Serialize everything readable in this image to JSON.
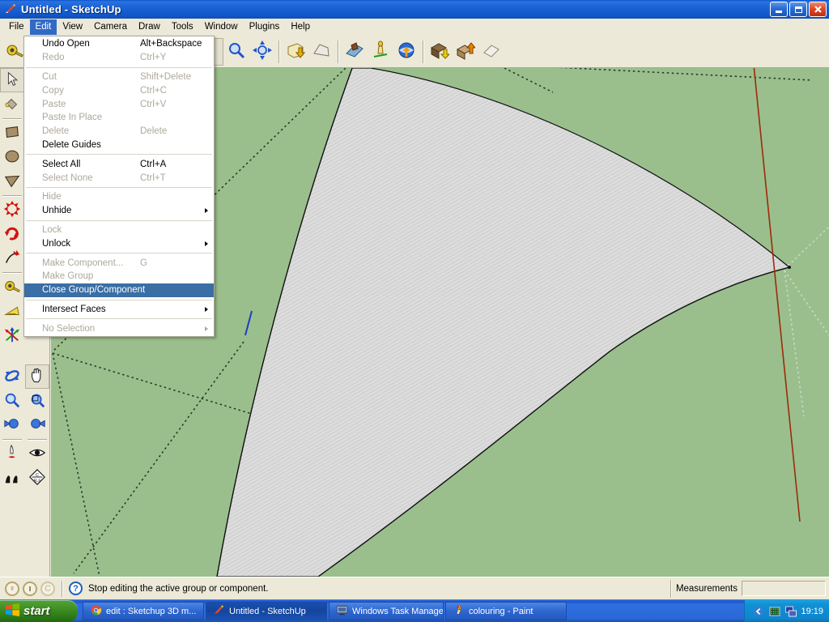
{
  "window": {
    "title": "Untitled - SketchUp",
    "icon": "sketchup-pencil-icon",
    "minimize_label": "Minimize",
    "maximize_label": "Restore",
    "close_label": "Close"
  },
  "menubar": {
    "items": [
      {
        "label": "File",
        "active": false
      },
      {
        "label": "Edit",
        "active": true
      },
      {
        "label": "View",
        "active": false
      },
      {
        "label": "Camera",
        "active": false
      },
      {
        "label": "Draw",
        "active": false
      },
      {
        "label": "Tools",
        "active": false
      },
      {
        "label": "Window",
        "active": false
      },
      {
        "label": "Plugins",
        "active": false
      },
      {
        "label": "Help",
        "active": false
      }
    ]
  },
  "edit_menu": {
    "items": [
      {
        "label": "Undo Open",
        "accel": "Alt+Backspace",
        "disabled": false,
        "submenu": false,
        "highlight": false
      },
      {
        "label": "Redo",
        "accel": "Ctrl+Y",
        "disabled": true,
        "submenu": false,
        "highlight": false
      },
      {
        "separator": true
      },
      {
        "label": "Cut",
        "accel": "Shift+Delete",
        "disabled": true,
        "submenu": false,
        "highlight": false
      },
      {
        "label": "Copy",
        "accel": "Ctrl+C",
        "disabled": true,
        "submenu": false,
        "highlight": false
      },
      {
        "label": "Paste",
        "accel": "Ctrl+V",
        "disabled": true,
        "submenu": false,
        "highlight": false
      },
      {
        "label": "Paste In Place",
        "accel": "",
        "disabled": true,
        "submenu": false,
        "highlight": false
      },
      {
        "label": "Delete",
        "accel": "Delete",
        "disabled": true,
        "submenu": false,
        "highlight": false
      },
      {
        "label": "Delete Guides",
        "accel": "",
        "disabled": false,
        "submenu": false,
        "highlight": false
      },
      {
        "separator": true
      },
      {
        "label": "Select All",
        "accel": "Ctrl+A",
        "disabled": false,
        "submenu": false,
        "highlight": false
      },
      {
        "label": "Select None",
        "accel": "Ctrl+T",
        "disabled": true,
        "submenu": false,
        "highlight": false
      },
      {
        "separator": true
      },
      {
        "label": "Hide",
        "accel": "",
        "disabled": true,
        "submenu": false,
        "highlight": false
      },
      {
        "label": "Unhide",
        "accel": "",
        "disabled": false,
        "submenu": true,
        "highlight": false
      },
      {
        "separator": true
      },
      {
        "label": "Lock",
        "accel": "",
        "disabled": true,
        "submenu": false,
        "highlight": false
      },
      {
        "label": "Unlock",
        "accel": "",
        "disabled": false,
        "submenu": true,
        "highlight": false
      },
      {
        "separator": true
      },
      {
        "label": "Make Component...",
        "accel": "G",
        "disabled": true,
        "submenu": false,
        "highlight": false
      },
      {
        "label": "Make Group",
        "accel": "",
        "disabled": true,
        "submenu": false,
        "highlight": false
      },
      {
        "label": "Close Group/Component",
        "accel": "",
        "disabled": false,
        "submenu": false,
        "highlight": true
      },
      {
        "separator": true
      },
      {
        "label": "Intersect Faces",
        "accel": "",
        "disabled": false,
        "submenu": true,
        "highlight": false
      },
      {
        "separator": true
      },
      {
        "label": "No Selection",
        "accel": "",
        "disabled": true,
        "submenu": true,
        "highlight": false
      }
    ]
  },
  "toolbar": {
    "groups": [
      {
        "buttons": [
          {
            "name": "tape-measure-tool",
            "pressed": false
          },
          {
            "name": "paint-bucket-tool",
            "pressed": false
          }
        ]
      },
      {
        "buttons": [
          {
            "name": "push-pull-tool",
            "pressed": false
          },
          {
            "name": "move-tool",
            "pressed": false
          },
          {
            "name": "rotate-tool",
            "pressed": false
          },
          {
            "name": "follow-me-tool",
            "pressed": false
          }
        ]
      },
      {
        "buttons": [
          {
            "name": "orbit-tool",
            "pressed": false
          },
          {
            "name": "pan-tool",
            "pressed": true
          },
          {
            "name": "zoom-tool",
            "pressed": false
          },
          {
            "name": "zoom-extents-tool",
            "pressed": false
          }
        ]
      },
      {
        "buttons": [
          {
            "name": "add-location-tool",
            "pressed": false
          },
          {
            "name": "toggle-terrain-tool",
            "pressed": false
          }
        ]
      },
      {
        "buttons": [
          {
            "name": "photo-textures-tool",
            "pressed": false
          },
          {
            "name": "add-person-tool",
            "pressed": false
          },
          {
            "name": "share-model-tool",
            "pressed": false
          }
        ]
      },
      {
        "buttons": [
          {
            "name": "get-models-tool",
            "pressed": false
          },
          {
            "name": "upload-model-tool",
            "pressed": false
          },
          {
            "name": "share-component-tool",
            "pressed": false
          }
        ]
      }
    ]
  },
  "sidebar": {
    "left_column": [
      {
        "name": "select-tool",
        "pressed": true
      },
      {
        "name": "paint-bucket-tool",
        "pressed": false
      },
      {
        "separator": true
      },
      {
        "name": "rectangle-tool",
        "pressed": false
      },
      {
        "name": "circle-tool",
        "pressed": false
      },
      {
        "name": "polygon-tool",
        "pressed": false
      },
      {
        "separator": true
      },
      {
        "name": "move-tool",
        "pressed": false
      },
      {
        "name": "rotate-tool",
        "pressed": false
      },
      {
        "name": "follow-me-tool",
        "pressed": false
      },
      {
        "separator": true
      },
      {
        "name": "tape-measure-tool",
        "pressed": false
      },
      {
        "name": "protractor-tool",
        "pressed": false
      },
      {
        "name": "axes-tool",
        "pressed": false
      }
    ],
    "bottom_left_column": [
      {
        "name": "orbit-tool",
        "pressed": false
      },
      {
        "name": "zoom-tool",
        "pressed": false
      },
      {
        "name": "previous-view-tool",
        "pressed": false
      },
      {
        "separator": true
      },
      {
        "name": "position-camera-tool",
        "pressed": false
      },
      {
        "name": "walk-tool",
        "pressed": false
      }
    ],
    "bottom_right_column": [
      {
        "name": "pan-tool",
        "pressed": true
      },
      {
        "name": "zoom-window-tool",
        "pressed": false
      },
      {
        "name": "next-view-tool",
        "pressed": false
      },
      {
        "separator": true
      },
      {
        "name": "look-around-tool",
        "pressed": false
      },
      {
        "name": "section-plane-tool",
        "pressed": false
      }
    ]
  },
  "canvas": {
    "background_color": "#9abf8d",
    "face_fill_color": "#d6d6d6",
    "edge_color": "#000000",
    "red_axis_color": "#b02000",
    "blue_axis_color": "#1a3fc0",
    "guide_color": "#2a3a28",
    "description": "SketchUp model view showing a large curved grey hatched face over a green ground plane with dotted guide lines and red axis"
  },
  "statusbar": {
    "geo_icons": [
      {
        "name": "geo-location-icon",
        "glyph": "♀",
        "dim": false
      },
      {
        "name": "shadow-person-icon",
        "glyph": "ı",
        "dim": false
      },
      {
        "name": "credits-icon",
        "glyph": "C",
        "dim": true
      }
    ],
    "help_icon": "help-question-icon",
    "message": "Stop editing the active group or component.",
    "measurements_label": "Measurements",
    "measurements_value": ""
  },
  "taskbar": {
    "start_label": "start",
    "tasks": [
      {
        "label": "edit : Sketchup 3D m...",
        "icon": "chrome-icon",
        "active": false
      },
      {
        "label": "Untitled - SketchUp",
        "icon": "sketchup-icon",
        "active": true
      },
      {
        "label": "Windows Task Manager",
        "icon": "taskmanager-icon",
        "active": false
      },
      {
        "label": "colouring - Paint",
        "icon": "paint-icon",
        "active": false
      }
    ],
    "tray": {
      "expand_icon": "chevron-left-icon",
      "icons": [
        "network-icon",
        "display-icon"
      ],
      "clock": "19:19"
    }
  }
}
